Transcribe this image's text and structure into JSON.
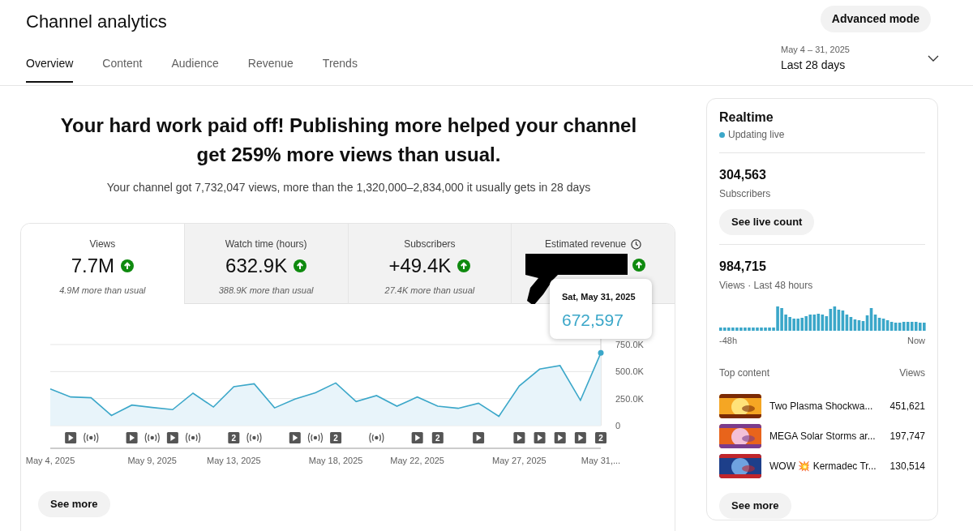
{
  "header": {
    "title": "Channel analytics",
    "advanced_button": "Advanced mode",
    "date_range": {
      "range": "May 4 – 31, 2025",
      "label": "Last 28 days"
    },
    "tabs": [
      {
        "label": "Overview",
        "selected": true
      },
      {
        "label": "Content",
        "selected": false
      },
      {
        "label": "Audience",
        "selected": false
      },
      {
        "label": "Revenue",
        "selected": false
      },
      {
        "label": "Trends",
        "selected": false
      }
    ]
  },
  "headline": "Your hard work paid off! Publishing more helped your channel get 259% more views than usual.",
  "summary": "Your channel got 7,732,047 views, more than the 1,320,000–2,834,000 it usually gets in 28 days",
  "metrics": [
    {
      "kind": "value",
      "label": "Views",
      "value": "7.7M",
      "note": "4.9M more than usual",
      "selected": true
    },
    {
      "kind": "value",
      "label": "Watch time (hours)",
      "value": "632.9K",
      "note": "388.9K more than usual",
      "selected": false
    },
    {
      "kind": "value",
      "label": "Subscribers",
      "value": "+49.4K",
      "note": "27.4K more than usual",
      "selected": false
    },
    {
      "kind": "redacted",
      "label": "Estimated revenue",
      "selected": false
    }
  ],
  "tooltip": {
    "date": "Sat, May 31, 2025",
    "value": "672,597"
  },
  "chart": {
    "chart_data": {
      "type": "area",
      "series": [
        {
          "color": "#3ba7c9",
          "values": [
            340000,
            265000,
            258000,
            94000,
            190000,
            168000,
            148000,
            300000,
            172000,
            360000,
            387000,
            164000,
            246000,
            304000,
            395000,
            223000,
            278000,
            180000,
            265000,
            180000,
            160000,
            207000,
            86000,
            367000,
            523000,
            555000,
            234000,
            672597
          ]
        }
      ],
      "ylim": [
        0,
        750000
      ],
      "yticks": [
        {
          "value": 0,
          "label": "0"
        },
        {
          "value": 250000,
          "label": "250.0K"
        },
        {
          "value": 500000,
          "label": "500.0K"
        },
        {
          "value": 750000,
          "label": "750.0K"
        }
      ],
      "categories": [
        "May 4, 2025",
        null,
        null,
        null,
        null,
        "May 9, 2025",
        null,
        null,
        null,
        "May 13, 2025",
        null,
        null,
        null,
        null,
        "May 18, 2025",
        null,
        null,
        null,
        "May 22, 2025",
        null,
        null,
        null,
        null,
        "May 27, 2025",
        null,
        null,
        null,
        "May 31,..."
      ]
    },
    "markers": [
      {
        "kind": "none"
      },
      {
        "kind": "video"
      },
      {
        "kind": "live"
      },
      {
        "kind": "none"
      },
      {
        "kind": "video"
      },
      {
        "kind": "live"
      },
      {
        "kind": "video"
      },
      {
        "kind": "live"
      },
      {
        "kind": "none"
      },
      {
        "kind": "count",
        "label": "2"
      },
      {
        "kind": "live"
      },
      {
        "kind": "none"
      },
      {
        "kind": "video"
      },
      {
        "kind": "live"
      },
      {
        "kind": "count",
        "label": "2"
      },
      {
        "kind": "none"
      },
      {
        "kind": "live"
      },
      {
        "kind": "none"
      },
      {
        "kind": "video"
      },
      {
        "kind": "count",
        "label": "2"
      },
      {
        "kind": "none"
      },
      {
        "kind": "video"
      },
      {
        "kind": "none"
      },
      {
        "kind": "video"
      },
      {
        "kind": "video"
      },
      {
        "kind": "video"
      },
      {
        "kind": "video"
      },
      {
        "kind": "count",
        "label": "2"
      }
    ]
  },
  "see_more_button": "See more",
  "realtime": {
    "title": "Realtime",
    "status": "Updating live",
    "subscribers": {
      "value": "304,563",
      "label": "Subscribers",
      "button": "See live count"
    },
    "views": {
      "value": "984,715",
      "label": "Views · Last 48 hours",
      "axis_start": "-48h",
      "axis_end": "Now"
    },
    "top_content": {
      "heading": "Top content",
      "column": "Views",
      "items": [
        {
          "title": "Two Plasma Shockwa...",
          "views": "451,621"
        },
        {
          "title": "MEGA Solar Storms ar...",
          "views": "197,747"
        },
        {
          "title": "WOW 💥 Kermadec Tr...",
          "views": "130,514"
        }
      ]
    },
    "see_more_button": "See more"
  }
}
